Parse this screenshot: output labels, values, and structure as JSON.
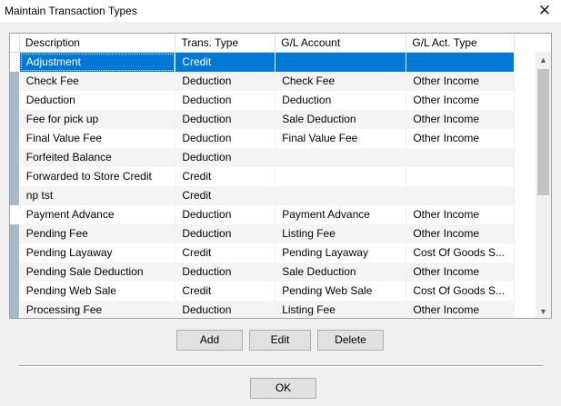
{
  "window": {
    "title": "Maintain Transaction Types"
  },
  "grid": {
    "columns": [
      "Description",
      "Trans. Type",
      "G/L Account",
      "G/L Act. Type"
    ],
    "rows": [
      {
        "description": "Adjustment",
        "trans_type": "Credit",
        "gl_account": "",
        "gl_act_type": "",
        "selected": true,
        "marked": false
      },
      {
        "description": "Check Fee",
        "trans_type": "Deduction",
        "gl_account": "Check Fee",
        "gl_act_type": "Other Income",
        "marked": true
      },
      {
        "description": "Deduction",
        "trans_type": "Deduction",
        "gl_account": "Deduction",
        "gl_act_type": "Other Income",
        "marked": true
      },
      {
        "description": "Fee for pick up",
        "trans_type": "Deduction",
        "gl_account": "Sale Deduction",
        "gl_act_type": "Other Income",
        "marked": true
      },
      {
        "description": "Final Value Fee",
        "trans_type": "Deduction",
        "gl_account": "Final Value Fee",
        "gl_act_type": "Other Income",
        "marked": true
      },
      {
        "description": "Forfeited Balance",
        "trans_type": "Deduction",
        "gl_account": "",
        "gl_act_type": "",
        "marked": true
      },
      {
        "description": "Forwarded to Store Credit",
        "trans_type": "Credit",
        "gl_account": "",
        "gl_act_type": "",
        "marked": true
      },
      {
        "description": "np tst",
        "trans_type": "Credit",
        "gl_account": "",
        "gl_act_type": "",
        "marked": true
      },
      {
        "description": "Payment Advance",
        "trans_type": "Deduction",
        "gl_account": "Payment Advance",
        "gl_act_type": "Other Income",
        "marked": false
      },
      {
        "description": "Pending Fee",
        "trans_type": "Deduction",
        "gl_account": "Listing Fee",
        "gl_act_type": "Other Income",
        "marked": true
      },
      {
        "description": "Pending Layaway",
        "trans_type": "Credit",
        "gl_account": "Pending Layaway",
        "gl_act_type": "Cost Of Goods S...",
        "marked": true
      },
      {
        "description": "Pending Sale Deduction",
        "trans_type": "Deduction",
        "gl_account": "Sale Deduction",
        "gl_act_type": "Other Income",
        "marked": true
      },
      {
        "description": "Pending Web Sale",
        "trans_type": "Credit",
        "gl_account": "Pending Web Sale",
        "gl_act_type": "Cost Of Goods S...",
        "marked": true
      },
      {
        "description": "Processing Fee",
        "trans_type": "Deduction",
        "gl_account": "Listing Fee",
        "gl_act_type": "Other Income",
        "marked": true
      }
    ]
  },
  "buttons": {
    "add": "Add",
    "edit": "Edit",
    "delete": "Delete",
    "ok": "OK"
  },
  "icons": {
    "close": "close-icon",
    "scroll_up": "scroll-up-icon",
    "scroll_down": "scroll-down-icon"
  },
  "colors": {
    "selection": "#0078d7",
    "row_marker": "#a9b9ca"
  }
}
